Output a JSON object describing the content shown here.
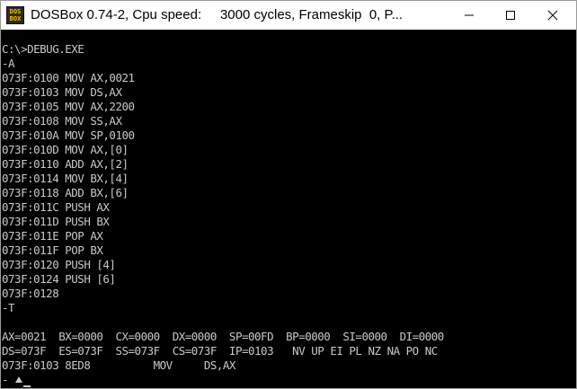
{
  "window": {
    "title": "DOSBox 0.74-2, Cpu speed:     3000 cycles, Frameskip  0, P...",
    "icon_name": "dosbox-app-icon",
    "icon_text_top": "DOS",
    "icon_text_bottom": "BOX",
    "minimize_glyph": "—",
    "maximize_glyph": "☐",
    "close_glyph": "✕"
  },
  "console": {
    "background": "#000000",
    "foreground": "#c8c8c8",
    "lines": [
      "C:\\>DEBUG.EXE",
      "-A",
      "073F:0100 MOV AX,0021",
      "073F:0103 MOV DS,AX",
      "073F:0105 MOV AX,2200",
      "073F:0108 MOV SS,AX",
      "073F:010A MOV SP,0100",
      "073F:010D MOV AX,[0]",
      "073F:0110 ADD AX,[2]",
      "073F:0114 MOV BX,[4]",
      "073F:0118 ADD BX,[6]",
      "073F:011C PUSH AX",
      "073F:011D PUSH BX",
      "073F:011E POP AX",
      "073F:011F POP BX",
      "073F:0120 PUSH [4]",
      "073F:0124 PUSH [6]",
      "073F:0128",
      "-T",
      "",
      "AX=0021  BX=0000  CX=0000  DX=0000  SP=00FD  BP=0000  SI=0000  DI=0000",
      "DS=073F  ES=073F  SS=073F  CS=073F  IP=0103   NV UP EI PL NZ NA PO NC",
      "073F:0103 8ED8          MOV     DS,AX",
      "-"
    ]
  }
}
